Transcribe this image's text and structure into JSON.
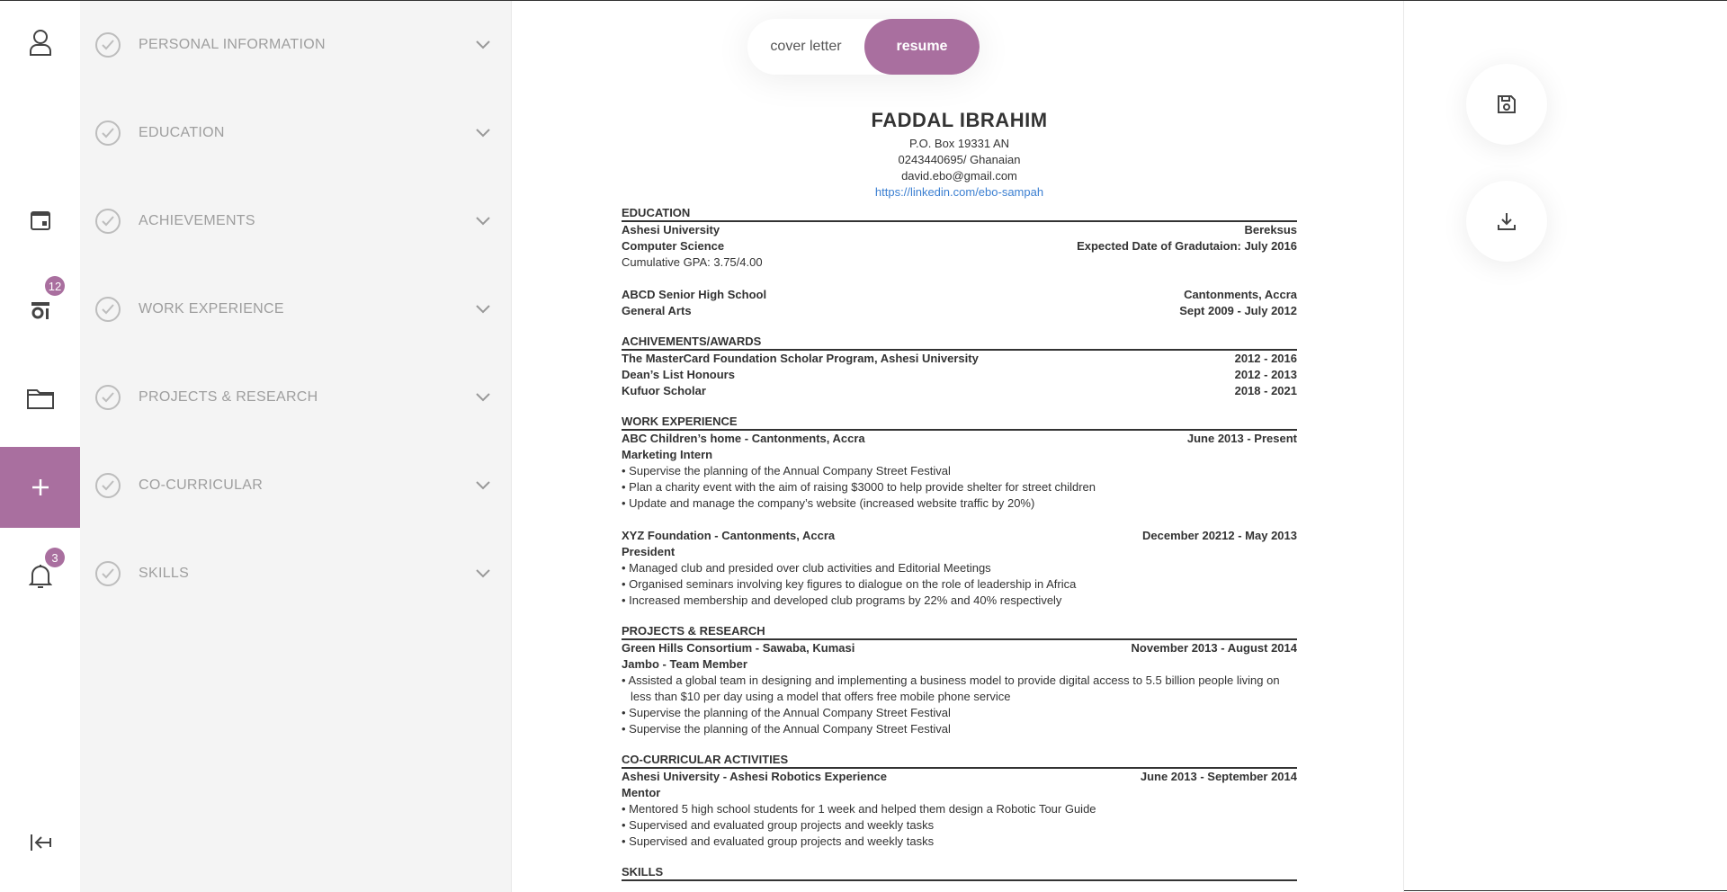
{
  "rail": {
    "items": [
      {
        "icon": "user-icon"
      },
      {
        "icon": "calendar-icon"
      },
      {
        "icon": "inbox-icon",
        "badge": "12"
      },
      {
        "icon": "folder-icon"
      },
      {
        "icon": "plus-icon"
      },
      {
        "icon": "bell-icon",
        "badge": "3"
      },
      {
        "icon": "logout-icon"
      }
    ],
    "accent": "#a96f9f"
  },
  "sections": [
    {
      "label": "PERSONAL INFORMATION"
    },
    {
      "label": "EDUCATION"
    },
    {
      "label": "ACHIEVEMENTS"
    },
    {
      "label": "WORK EXPERIENCE"
    },
    {
      "label": "PROJECTS & RESEARCH"
    },
    {
      "label": "CO-CURRICULAR"
    },
    {
      "label": "SKILLS"
    }
  ],
  "toggle": {
    "cover_letter": "cover letter",
    "resume": "resume"
  },
  "resume": {
    "name": "FADDAL IBRAHIM",
    "address": "P.O. Box 19331 AN",
    "phone": "0243440695/ Ghanaian",
    "email": "david.ebo@gmail.com",
    "linkedin": "https://linkedin.com/ebo-sampah",
    "education_heading": "EDUCATION",
    "edu1_school": "Ashesi University",
    "edu1_location": "Bereksus",
    "edu1_program": "Computer Science",
    "edu1_date": "Expected Date of Gradutaion: July 2016",
    "edu1_gpa": "Cumulative GPA: 3.75/4.00",
    "edu2_school": "ABCD Senior High School",
    "edu2_location": "Cantonments, Accra",
    "edu2_program": "General Arts",
    "edu2_date": "Sept 2009 - July 2012",
    "awards_heading": "ACHIVEMENTS/AWARDS",
    "award1": "The MasterCard Foundation Scholar Program, Ashesi University",
    "award1_date": "2012 - 2016",
    "award2": "Dean’s List Honours",
    "award2_date": "2012 - 2013",
    "award3": "Kufuor Scholar",
    "award3_date": "2018 - 2021",
    "work_heading": "WORK EXPERIENCE",
    "work1_org": "ABC Children’s home - Cantonments, Accra",
    "work1_date": "June 2013 - Present",
    "work1_role": "Marketing Intern",
    "work1_b1": "• Supervise the planning of the Annual Company Street Festival",
    "work1_b2": "• Plan a charity event with the aim of raising $3000 to help provide shelter for street children",
    "work1_b3": "• Update and manage the company’s website (increased website traffic by 20%)",
    "work2_org": "XYZ Foundation - Cantonments, Accra",
    "work2_date": "December 20212 - May 2013",
    "work2_role": "President",
    "work2_b1": "• Managed club and presided over club activities and Editorial Meetings",
    "work2_b2": "• Organised seminars involving key figures to dialogue on the role of leadership in Africa",
    "work2_b3": "• Increased membership and developed club programs by 22% and 40% respectively",
    "proj_heading": "PROJECTS & RESEARCH",
    "proj1_org": "Green Hills Consortium - Sawaba, Kumasi",
    "proj1_date": "November 2013 - August 2014",
    "proj1_role": "Jambo - Team Member",
    "proj1_b1": "• Assisted a global team in designing and implementing a business model to provide digital access to 5.5 billion people living on less than $10 per day using a model that offers free mobile phone service",
    "proj1_b2": "• Supervise the planning of the Annual Company Street Festival",
    "proj1_b3": "• Supervise the planning of the Annual Company Street Festival",
    "cc_heading": "CO-CURRICULAR ACTIVITIES",
    "cc1_org": "Ashesi University - Ashesi Robotics Experience",
    "cc1_date": "June 2013 - September 2014",
    "cc1_role": "Mentor",
    "cc1_b1": "• Mentored 5 high school students for 1 week and helped them design a Robotic Tour Guide",
    "cc1_b2": "• Supervised and evaluated group projects and weekly tasks",
    "cc1_b3": "• Supervised and evaluated group projects and weekly tasks",
    "skills_heading": "SKILLS"
  },
  "actions": {
    "save_icon": "save-icon",
    "download_icon": "download-icon"
  }
}
